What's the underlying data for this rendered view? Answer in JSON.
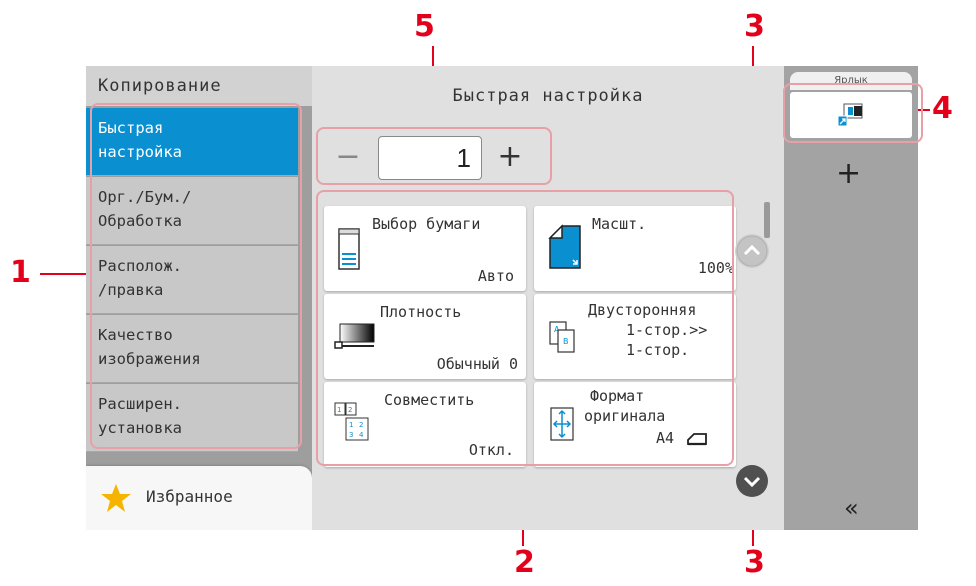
{
  "callouts": {
    "n1": "1",
    "n2": "2",
    "n3a": "3",
    "n3b": "3",
    "n4": "4",
    "n5": "5"
  },
  "left_panel": {
    "title": "Копирование",
    "tabs": [
      {
        "line1": "Быстрая",
        "line2": "настройка"
      },
      {
        "line1": "Орг./Бум./",
        "line2": "Обработка"
      },
      {
        "line1": "Располож.",
        "line2": "/правка"
      },
      {
        "line1": "Качество",
        "line2": "изображения"
      },
      {
        "line1": "Расширен.",
        "line2": "установка"
      }
    ],
    "favorites_label": "Избранное"
  },
  "main": {
    "title": "Быстрая настройка",
    "copies": {
      "minus": "−",
      "value": "1",
      "plus": "+"
    },
    "cards": {
      "paper": {
        "title": "Выбор бумаги",
        "value": "Авто"
      },
      "zoom": {
        "title": "Масшт.",
        "value": "100%"
      },
      "density": {
        "title": "Плотность",
        "value": "Обычный 0"
      },
      "duplex": {
        "title": "Двусторонняя",
        "value1": "1-стор.>>",
        "value2": "1-стор."
      },
      "combine": {
        "title": "Совместить",
        "value": "Откл."
      },
      "orig_size": {
        "title1": "Формат",
        "title2": "оригинала",
        "value": "A4"
      }
    }
  },
  "right_panel": {
    "tab_stub": "Ярлык",
    "add": "+",
    "collapse": "«"
  },
  "colors": {
    "accent": "#0a8fd0",
    "callout": "#e2001a",
    "highlight": "#e8a0a8"
  }
}
